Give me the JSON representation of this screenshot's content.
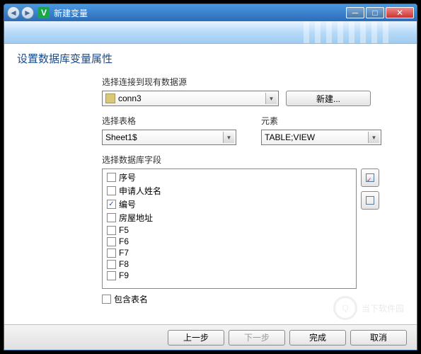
{
  "titlebar": {
    "app_icon_text": "V",
    "title": "新建变量",
    "back_glyph": "◄",
    "fwd_glyph": "►",
    "min_glyph": "─",
    "max_glyph": "□",
    "close_glyph": "✕"
  },
  "heading": "设置数据库变量属性",
  "labels": {
    "datasource": "选择连接到现有数据源",
    "table": "选择表格",
    "element": "元素",
    "fields": "选择数据库字段",
    "include_table": "包含表名"
  },
  "datasource": {
    "value": "conn3"
  },
  "new_button": "新建...",
  "table_select": {
    "value": "Sheet1$"
  },
  "element_select": {
    "value": "TABLE;VIEW"
  },
  "fields": [
    {
      "label": "序号",
      "checked": false
    },
    {
      "label": "申请人姓名",
      "checked": false
    },
    {
      "label": "编号",
      "checked": true
    },
    {
      "label": "房屋地址",
      "checked": false
    },
    {
      "label": "F5",
      "checked": false
    },
    {
      "label": "F6",
      "checked": false
    },
    {
      "label": "F7",
      "checked": false
    },
    {
      "label": "F8",
      "checked": false
    },
    {
      "label": "F9",
      "checked": false
    }
  ],
  "include_checked": false,
  "footer": {
    "prev": "上一步",
    "next": "下一步",
    "finish": "完成",
    "cancel": "取消"
  },
  "watermark": {
    "glyph": "Q",
    "text": "当下软件园"
  }
}
